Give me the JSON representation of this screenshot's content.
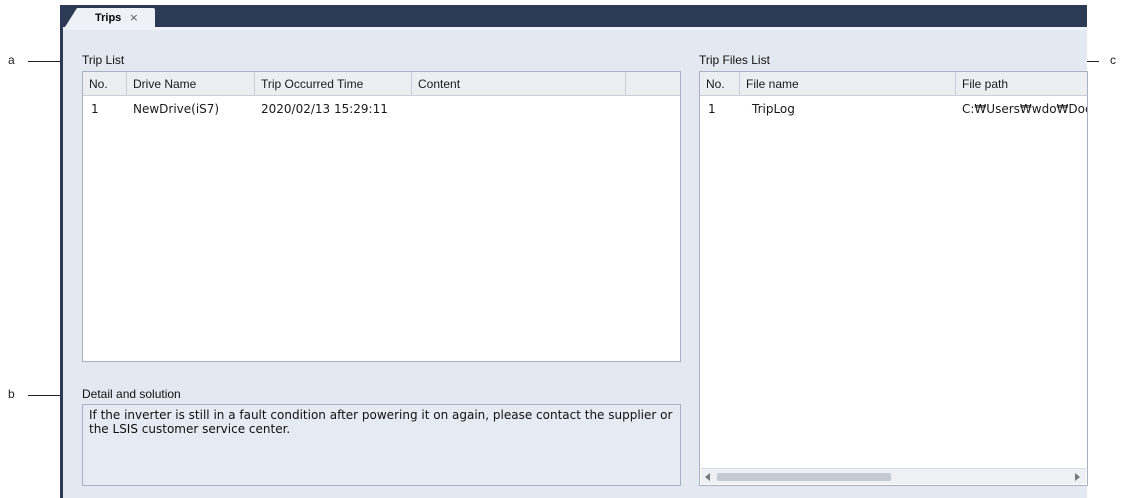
{
  "tab": {
    "label": "Trips",
    "close": "×"
  },
  "annotations": {
    "a": "a",
    "b": "b",
    "c": "c"
  },
  "trip_list": {
    "title": "Trip List",
    "columns": [
      "No.",
      "Drive Name",
      "Trip Occurred Time",
      "Content"
    ],
    "rows": [
      {
        "no": "1",
        "drive_name": "NewDrive(iS7)",
        "time": "2020/02/13 15:29:11",
        "content": ""
      }
    ]
  },
  "detail": {
    "title": "Detail and solution",
    "text": "If the inverter is still in a fault condition after powering it on again, please contact the supplier or the LSIS customer service center."
  },
  "trip_files": {
    "title": "Trip Files List",
    "columns": [
      "No.",
      "File name",
      "File path"
    ],
    "rows": [
      {
        "no": "1",
        "file_name": "TripLog",
        "file_path": "C:₩Users₩wdo₩Doc"
      }
    ]
  }
}
